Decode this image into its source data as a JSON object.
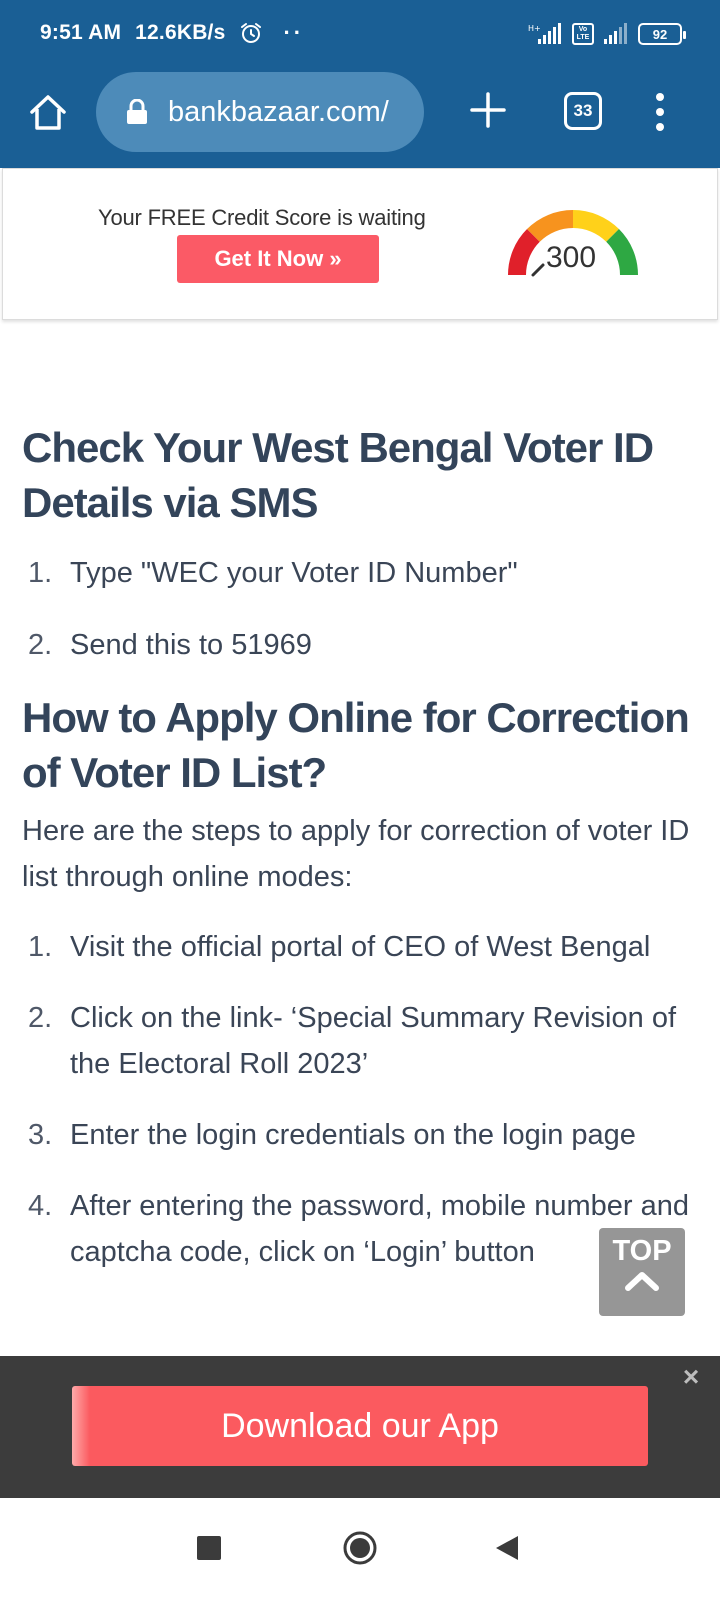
{
  "status_bar": {
    "time": "9:51 AM",
    "speed": "12.6KB/s",
    "dots": "··",
    "battery": "92",
    "volte_label": "Vo LTE",
    "icons": [
      "alarm-icon",
      "signal-icon",
      "volte-icon",
      "battery-icon"
    ]
  },
  "toolbar": {
    "url": "bankbazaar.com/",
    "tab_count": "33",
    "icons": [
      "home-icon",
      "lock-icon",
      "plus-icon",
      "tabs-icon",
      "menu-icon"
    ]
  },
  "ad": {
    "text": "Your FREE Credit Score is waiting",
    "button": "Get It Now »",
    "gauge_value": "300",
    "gauge_colors": [
      "#e0202a",
      "#f7931e",
      "#ffd11a",
      "#2ea843"
    ]
  },
  "article": {
    "heading1": "Check Your West Bengal Voter ID Details via SMS",
    "sms_steps": [
      {
        "num": "1.",
        "text": "Type \"WEC your Voter ID Number\""
      },
      {
        "num": "2.",
        "text": "Send this to 51969"
      }
    ],
    "heading2": "How to Apply Online for Correction of Voter ID List?",
    "intro": "Here are the steps to apply for correction of voter ID list through online modes:",
    "online_steps": [
      {
        "num": "1.",
        "text": "Visit the official portal of CEO of West Bengal"
      },
      {
        "num": "2.",
        "text": "Click on the link- ‘Special Summary Revision of the Electoral Roll 2023’"
      },
      {
        "num": "3.",
        "text": "Enter the login credentials on the login page"
      },
      {
        "num": "4.",
        "text": "After entering the password, mobile number and captcha code, click on ‘Login’ button"
      }
    ]
  },
  "top_button": {
    "label": "TOP"
  },
  "app_banner": {
    "button": "Download our App",
    "close": "×"
  },
  "nav": {
    "icons": [
      "recents-icon",
      "home-circle-icon",
      "back-icon"
    ]
  }
}
